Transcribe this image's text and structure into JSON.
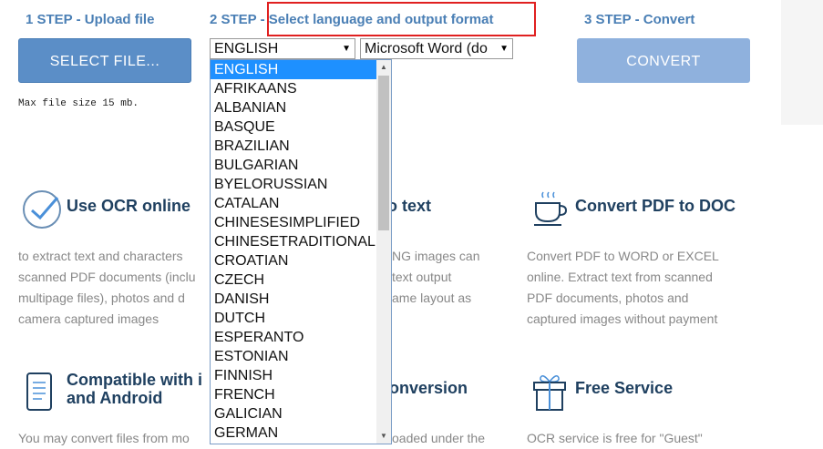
{
  "steps": {
    "step1": "1 STEP - Upload file",
    "step2_prefix": "2 STEP - ",
    "step2_highlight": "Select language and output format",
    "step3": "3 STEP - Convert"
  },
  "buttons": {
    "select_file": "SELECT FILE...",
    "convert": "CONVERT"
  },
  "max_size": "Max file size 15 mb.",
  "language_select": {
    "value": "ENGLISH"
  },
  "format_select": {
    "value": "Microsoft Word (do"
  },
  "language_options": [
    "ENGLISH",
    "AFRIKAANS",
    "ALBANIAN",
    "BASQUE",
    "BRAZILIAN",
    "BULGARIAN",
    "BYELORUSSIAN",
    "CATALAN",
    "CHINESESIMPLIFIED",
    "CHINESETRADITIONAL",
    "CROATIAN",
    "CZECH",
    "DANISH",
    "DUTCH",
    "ESPERANTO",
    "ESTONIAN",
    "FINNISH",
    "FRENCH",
    "GALICIAN",
    "GERMAN"
  ],
  "features": {
    "ocr": {
      "title": "Use OCR online",
      "lines": [
        "to extract text and characters",
        "scanned PDF documents (inclu",
        "multipage files), photos and d",
        "camera captured images"
      ]
    },
    "jpg": {
      "title": "o text",
      "lines": [
        "NG images can",
        "text output",
        "ame layout as"
      ]
    },
    "pdf": {
      "title": "Convert PDF to DOC",
      "lines": [
        "Convert PDF to WORD or EXCEL",
        "online. Extract text from scanned",
        "PDF documents, photos and",
        "captured images without payment"
      ]
    },
    "mobile": {
      "title1": "Compatible with i",
      "title2": "and Android",
      "line": "You may convert files from mo"
    },
    "conversion": {
      "title": "onversion",
      "line": "oaded under the"
    },
    "free": {
      "title": "Free Service",
      "line": "OCR service is free for \"Guest\""
    }
  },
  "colors": {
    "accent": "#5b8ec7",
    "step": "#4a7fb5",
    "highlight_border": "#e02020",
    "selected_option": "#1e90ff"
  }
}
